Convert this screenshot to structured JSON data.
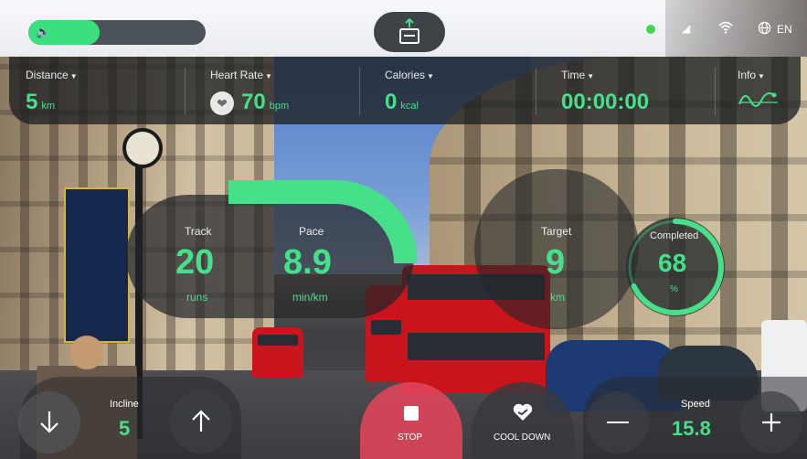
{
  "topbar": {
    "volume_level": 0.4,
    "language": "EN",
    "icons": [
      "volume-icon",
      "upload-icon",
      "status-dot",
      "signal-icon",
      "wifi-icon",
      "globe-icon"
    ]
  },
  "stats": {
    "distance": {
      "label": "Distance",
      "value": "5",
      "unit": "km"
    },
    "heart_rate": {
      "label": "Heart Rate",
      "value": "70",
      "unit": "bpm"
    },
    "calories": {
      "label": "Calories",
      "value": "0",
      "unit": "kcal"
    },
    "time": {
      "label": "Time",
      "value": "00:00:00"
    },
    "info": {
      "label": "Info"
    }
  },
  "workout": {
    "track": {
      "label": "Track",
      "value": "20",
      "unit": "runs"
    },
    "pace": {
      "label": "Pace",
      "value": "8.9",
      "unit": "min/km"
    },
    "target": {
      "label": "Target",
      "value": "9",
      "unit": "km"
    },
    "completed": {
      "label": "Completed",
      "value": "68",
      "unit": "%",
      "progress": 0.68
    }
  },
  "controls": {
    "incline": {
      "label": "Incline",
      "value": "5"
    },
    "stop_label": "STOP",
    "cooldown_label": "COOL DOWN",
    "speed": {
      "label": "Speed",
      "value": "15.8"
    }
  },
  "colors": {
    "accent": "#46e08a",
    "stop": "#e1465a",
    "panel": "#23262a"
  }
}
